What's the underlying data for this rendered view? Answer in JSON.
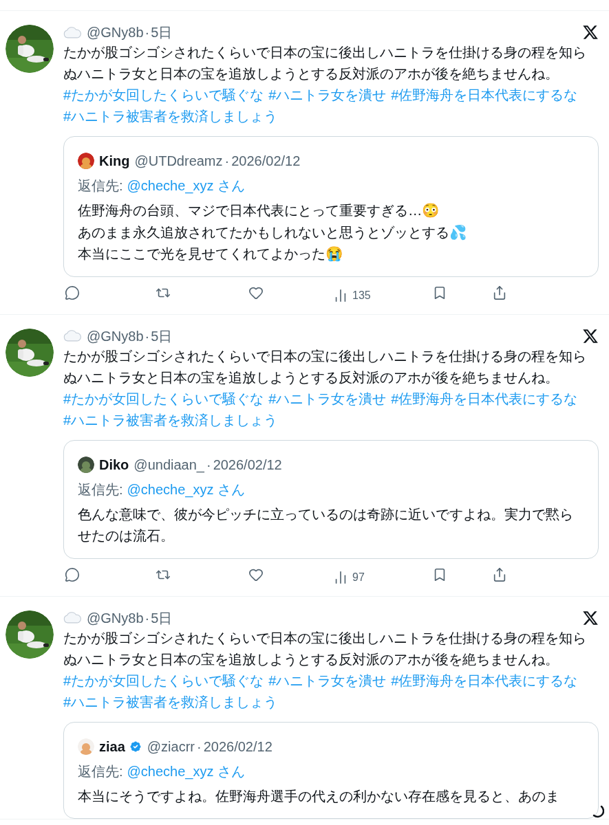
{
  "tweets": [
    {
      "handle": "@GNy8b",
      "separator": "·",
      "time": "5日",
      "text": "たかが股ゴシゴシされたくらいで日本の宝に後出しハニトラを仕掛ける身の程を知らぬハニトラ女と日本の宝を追放しようとする反対派のアホが後を絶ちませんね。",
      "hashtags": [
        "#たかが女回したくらいで騒ぐな",
        "#ハニトラ女を潰せ",
        "#佐野海舟を日本代表にするな",
        "#ハニトラ被害者を救済しましょう"
      ],
      "quote": {
        "name": "King",
        "verified": false,
        "handle": "@UTDdreamz",
        "separator": "·",
        "date": "2026/02/12",
        "reply_label": "返信先:",
        "reply_to": "@cheche_xyz",
        "reply_suffix": "さん",
        "text": "佐野海舟の台頭、マジで日本代表にとって重要すぎる…😳\nあのまま永久追放されてたかもしれないと思うとゾッとする💦\n本当にここで光を見せてくれてよかった😭"
      },
      "views": "135"
    },
    {
      "handle": "@GNy8b",
      "separator": "·",
      "time": "5日",
      "text": "たかが股ゴシゴシされたくらいで日本の宝に後出しハニトラを仕掛ける身の程を知らぬハニトラ女と日本の宝を追放しようとする反対派のアホが後を絶ちませんね。",
      "hashtags": [
        "#たかが女回したくらいで騒ぐな",
        "#ハニトラ女を潰せ",
        "#佐野海舟を日本代表にするな",
        "#ハニトラ被害者を救済しましょう"
      ],
      "quote": {
        "name": "Diko",
        "verified": false,
        "handle": "@undiaan_",
        "separator": "·",
        "date": "2026/02/12",
        "reply_label": "返信先:",
        "reply_to": "@cheche_xyz",
        "reply_suffix": "さん",
        "text": "色んな意味で、彼が今ピッチに立っているのは奇跡に近いですよね。実力で黙らせたのは流石。"
      },
      "views": "97"
    },
    {
      "handle": "@GNy8b",
      "separator": "·",
      "time": "5日",
      "text": "たかが股ゴシゴシされたくらいで日本の宝に後出しハニトラを仕掛ける身の程を知らぬハニトラ女と日本の宝を追放しようとする反対派のアホが後を絶ちませんね。",
      "hashtags": [
        "#たかが女回したくらいで騒ぐな",
        "#ハニトラ女を潰せ",
        "#佐野海舟を日本代表にするな",
        "#ハニトラ被害者を救済しましょう"
      ],
      "quote": {
        "name": "ziaa",
        "verified": true,
        "handle": "@ziacrr",
        "separator": "·",
        "date": "2026/02/12",
        "reply_label": "返信先:",
        "reply_to": "@cheche_xyz",
        "reply_suffix": "さん",
        "text": "本当にそうですよね。佐野海舟選手の代えの利かない存在感を見ると、あのま"
      }
    }
  ],
  "loading": true
}
